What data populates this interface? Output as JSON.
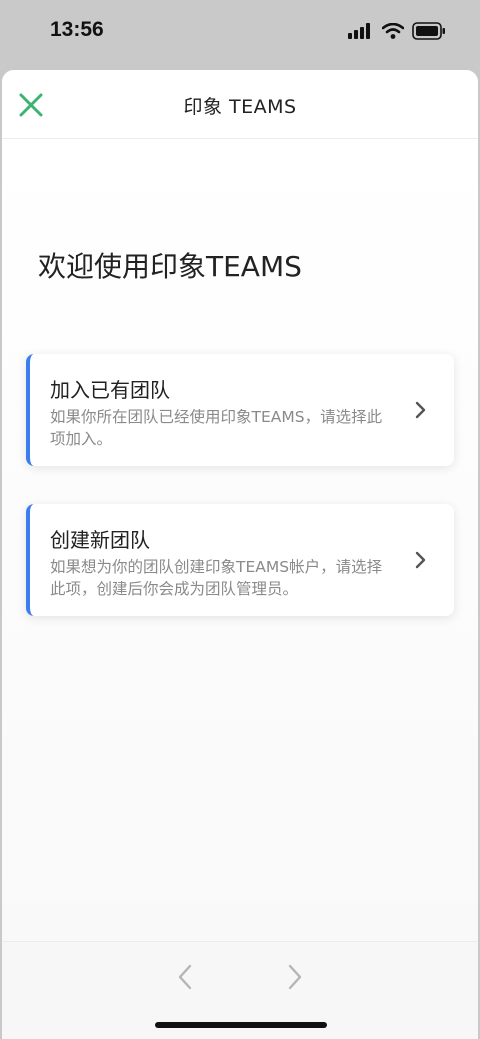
{
  "status_bar": {
    "time": "13:56",
    "signal_icon": "cellular-signal-icon",
    "wifi_icon": "wifi-icon",
    "battery_icon": "battery-icon"
  },
  "header": {
    "title": "印象 TEAMS",
    "close_icon": "close-icon",
    "accent_color": "#3cb371"
  },
  "welcome": {
    "title": "欢迎使用印象TEAMS"
  },
  "options": [
    {
      "title": "加入已有团队",
      "description": "如果你所在团队已经使用印象TEAMS，请选择此项加入。",
      "icon": "chevron-right-icon"
    },
    {
      "title": "创建新团队",
      "description": "如果想为你的团队创建印象TEAMS帐户，请选择此项，创建后你会成为团队管理员。",
      "icon": "chevron-right-icon"
    }
  ],
  "footer": {
    "prev_icon": "chevron-left-icon",
    "next_icon": "chevron-right-icon"
  },
  "colors": {
    "card_accent": "#3b7cf0"
  }
}
